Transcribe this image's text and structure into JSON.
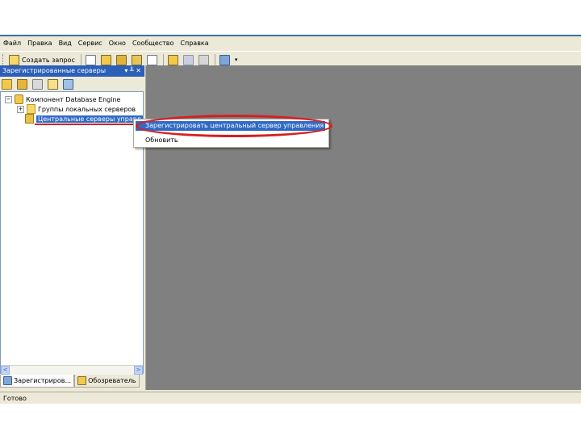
{
  "menu": [
    "Файл",
    "Правка",
    "Вид",
    "Сервис",
    "Окно",
    "Сообщество",
    "Справка"
  ],
  "toolbar": {
    "new_query_label": "Создать запрос",
    "icons": [
      "new-query-icon",
      "new-file-icon",
      "database-query-icon",
      "analysis-query-icon",
      "mdx-query-icon",
      "xmla-query-icon",
      "open-file-icon",
      "save-icon",
      "print-icon",
      "registered-servers-icon",
      "overflow-icon"
    ]
  },
  "panel": {
    "title": "Зарегистрированные серверы",
    "controls": "▾ ╨ ✕",
    "tree": {
      "root": "Компонент Database Engine",
      "child1": "Группы локальных серверов",
      "child2": "Центральные серверы управл"
    },
    "scroll_left": "<",
    "scroll_right": ">"
  },
  "bottom_tabs": [
    {
      "label": "Зарегистриров..."
    },
    {
      "label": "Обозреватель"
    }
  ],
  "context_menu": {
    "item1": "Зарегистрировать центральный сервер управления",
    "item2": "Обновить"
  },
  "status": "Готово",
  "colors": {
    "accent": "#316ac5",
    "highlight_mark": "#d42020",
    "workspace": "#808080"
  }
}
